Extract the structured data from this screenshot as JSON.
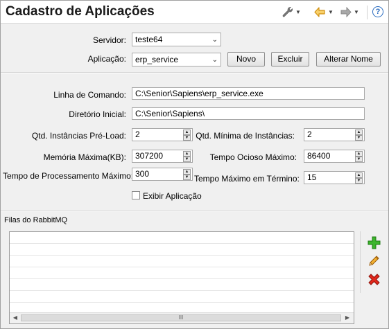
{
  "window": {
    "title": "Cadastro de Aplicações"
  },
  "toolbar": {
    "tools_icon": "wrench-icon",
    "back_icon": "arrow-left-icon",
    "forward_icon": "arrow-right-icon",
    "help_label": "?"
  },
  "form": {
    "servidor": {
      "label": "Servidor:",
      "value": "teste64"
    },
    "aplicacao": {
      "label": "Aplicação:",
      "value": "erp_service"
    },
    "buttons": {
      "novo": "Novo",
      "excluir": "Excluir",
      "alterar_nome": "Alterar Nome"
    },
    "linha_comando": {
      "label": "Linha de Comando:",
      "value": "C:\\Senior\\Sapiens\\erp_service.exe"
    },
    "diretorio_inicial": {
      "label": "Diretório Inicial:",
      "value": "C:\\Senior\\Sapiens\\"
    },
    "qtd_instancias_preload": {
      "label": "Qtd. Instâncias Pré-Load:",
      "value": "2"
    },
    "qtd_minima_instancias": {
      "label": "Qtd. Mínima de Instâncias:",
      "value": "2"
    },
    "memoria_maxima": {
      "label": "Memória Máxima(KB):",
      "value": "307200"
    },
    "tempo_ocioso_maximo": {
      "label": "Tempo Ocioso Máximo:",
      "value": "86400"
    },
    "tempo_processamento_maximo": {
      "label": "Tempo de Processamento Máximo:",
      "value": "300"
    },
    "tempo_maximo_termino": {
      "label": "Tempo Máximo em Término:",
      "value": "15"
    },
    "exibir_aplicacao": {
      "label": "Exibir Aplicação",
      "checked": false
    }
  },
  "rabbitmq": {
    "section_label": "Filas do RabbitMQ",
    "scroll_thumb_label": "III",
    "actions": {
      "add_icon": "plus-icon",
      "edit_icon": "pencil-icon",
      "delete_icon": "red-x-icon"
    }
  },
  "colors": {
    "add": "#2e9e22",
    "edit": "#e59a1c",
    "delete": "#d0201a",
    "help": "#2a6cc0",
    "back": "#e7a318"
  }
}
